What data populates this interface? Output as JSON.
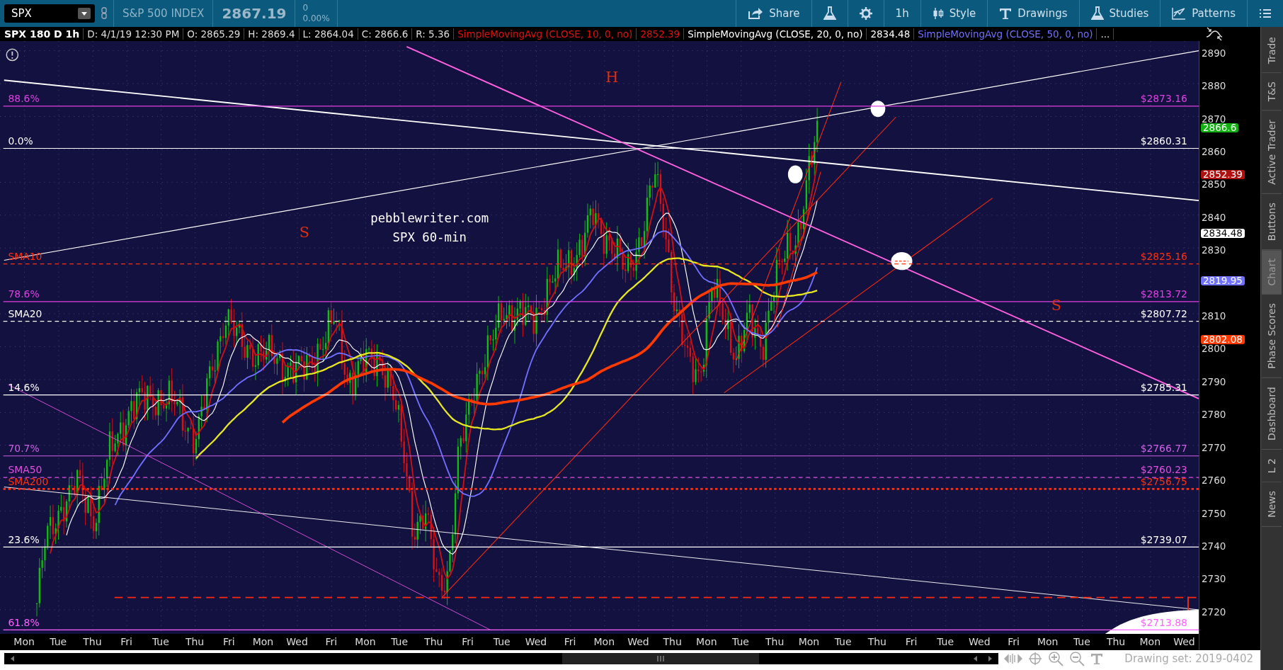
{
  "toolbar": {
    "symbol": "SPX",
    "description": "S&P 500 INDEX",
    "last_price": "2867.19",
    "change": "0",
    "change_percent": "0.00%",
    "buttons": [
      {
        "kind": "share",
        "label": "Share"
      },
      {
        "kind": "flask"
      },
      {
        "kind": "gear"
      },
      {
        "kind": "interval",
        "label": "1h"
      },
      {
        "kind": "style",
        "label": "Style"
      },
      {
        "kind": "drawings",
        "label": "Drawings"
      },
      {
        "kind": "studies",
        "label": "Studies"
      },
      {
        "kind": "patterns",
        "label": "Patterns"
      },
      {
        "kind": "menu"
      }
    ]
  },
  "info_bar": {
    "title": "SPX 180 D 1h",
    "fields": [
      "D: 4/1/19 12:30 PM",
      "O: 2865.29",
      "H: 2869.4",
      "L: 2864.04",
      "C: 2866.6",
      "R: 5.36"
    ],
    "studies": [
      {
        "name": "SimpleMovingAvg (CLOSE, 10, 0, no)",
        "value": "2852.39",
        "color": "#e01010"
      },
      {
        "name": "SimpleMovingAvg (CLOSE, 20, 0, no)",
        "value": "2834.48",
        "color": "#ffffff"
      },
      {
        "name": "SimpleMovingAvg (CLOSE, 50, 0, no)",
        "color": "#7070ff"
      }
    ],
    "more": "..."
  },
  "chart": {
    "annotations": [
      "H",
      "S",
      "S"
    ],
    "watermark": [
      "pebblewriter.com",
      "SPX 60-min"
    ],
    "levels": [
      {
        "label": "88.6%",
        "price": "$2873.16",
        "color": "#e040e0",
        "kind": "solid"
      },
      {
        "label": "0.0%",
        "price": "$2860.31",
        "color": "#ffffff",
        "kind": "solid"
      },
      {
        "label": "SMA10",
        "price": "$2825.16",
        "color": "#ff3010",
        "kind": "dashed"
      },
      {
        "label": "78.6%",
        "price": "$2813.72",
        "color": "#e040e0",
        "kind": "solid"
      },
      {
        "label": "SMA20",
        "price": "$2807.72",
        "color": "#ffffff",
        "kind": "dashed"
      },
      {
        "label": "14.6%",
        "price": "$2785.31",
        "color": "#ffffff",
        "kind": "solid"
      },
      {
        "label": "70.7%",
        "price": "$2766.77",
        "color": "#d060e8",
        "kind": "solid"
      },
      {
        "label": "SMA50",
        "price": "$2760.23",
        "color": "#e050e0",
        "kind": "dashed"
      },
      {
        "label": "SMA200",
        "price": "$2756.75",
        "color": "#ff3010",
        "kind": "dotted"
      },
      {
        "label": "23.6%",
        "price": "$2739.07",
        "color": "#ffffff",
        "kind": "solid"
      },
      {
        "label": "61.8%",
        "price": "$2713.88",
        "color": "#ff60ff",
        "kind": "solid"
      }
    ],
    "y_ticks": [
      "2890",
      "2880",
      "2870",
      "2860",
      "2850",
      "2840",
      "2830",
      "2810",
      "2800",
      "2790",
      "2780",
      "2770",
      "2760",
      "2750",
      "2740",
      "2730",
      "2720"
    ],
    "price_badges": [
      {
        "value": "2866.6",
        "color": "#10b010"
      },
      {
        "value": "2852.39",
        "color": "#b01010"
      },
      {
        "value": "2834.48",
        "color": "#ffffff"
      },
      {
        "value": "2819.95",
        "color": "#7070ff"
      },
      {
        "value": "2802.08",
        "color": "#ff3a00"
      }
    ],
    "x_labels": [
      "Mon",
      "Tue",
      "Thu",
      "Fri",
      "Tue",
      "Thu",
      "Fri",
      "Mon",
      "Wed",
      "Fri",
      "Mon",
      "Tue",
      "Thu",
      "Fri",
      "Tue",
      "Wed",
      "Fri",
      "Mon",
      "Wed",
      "Thu",
      "Mon",
      "Tue",
      "Thu",
      "Mon",
      "Tue",
      "Thu",
      "Fri",
      "Tue",
      "Wed",
      "Fri",
      "Mon",
      "Tue",
      "Thu",
      "Mon",
      "Wed"
    ]
  },
  "sidebar_tabs": [
    {
      "label": "Trade",
      "selected": false
    },
    {
      "label": "T&S",
      "selected": false
    },
    {
      "label": "Active Trader",
      "selected": false
    },
    {
      "label": "Buttons",
      "selected": false
    },
    {
      "label": "Chart",
      "selected": true
    },
    {
      "label": "Phase Scores",
      "selected": false
    },
    {
      "label": "Dashboard",
      "selected": false
    },
    {
      "label": "L 2",
      "selected": false
    },
    {
      "label": "News",
      "selected": false
    }
  ],
  "status_bar": {
    "drawing_set": "Drawing set: 2019-0402"
  }
}
